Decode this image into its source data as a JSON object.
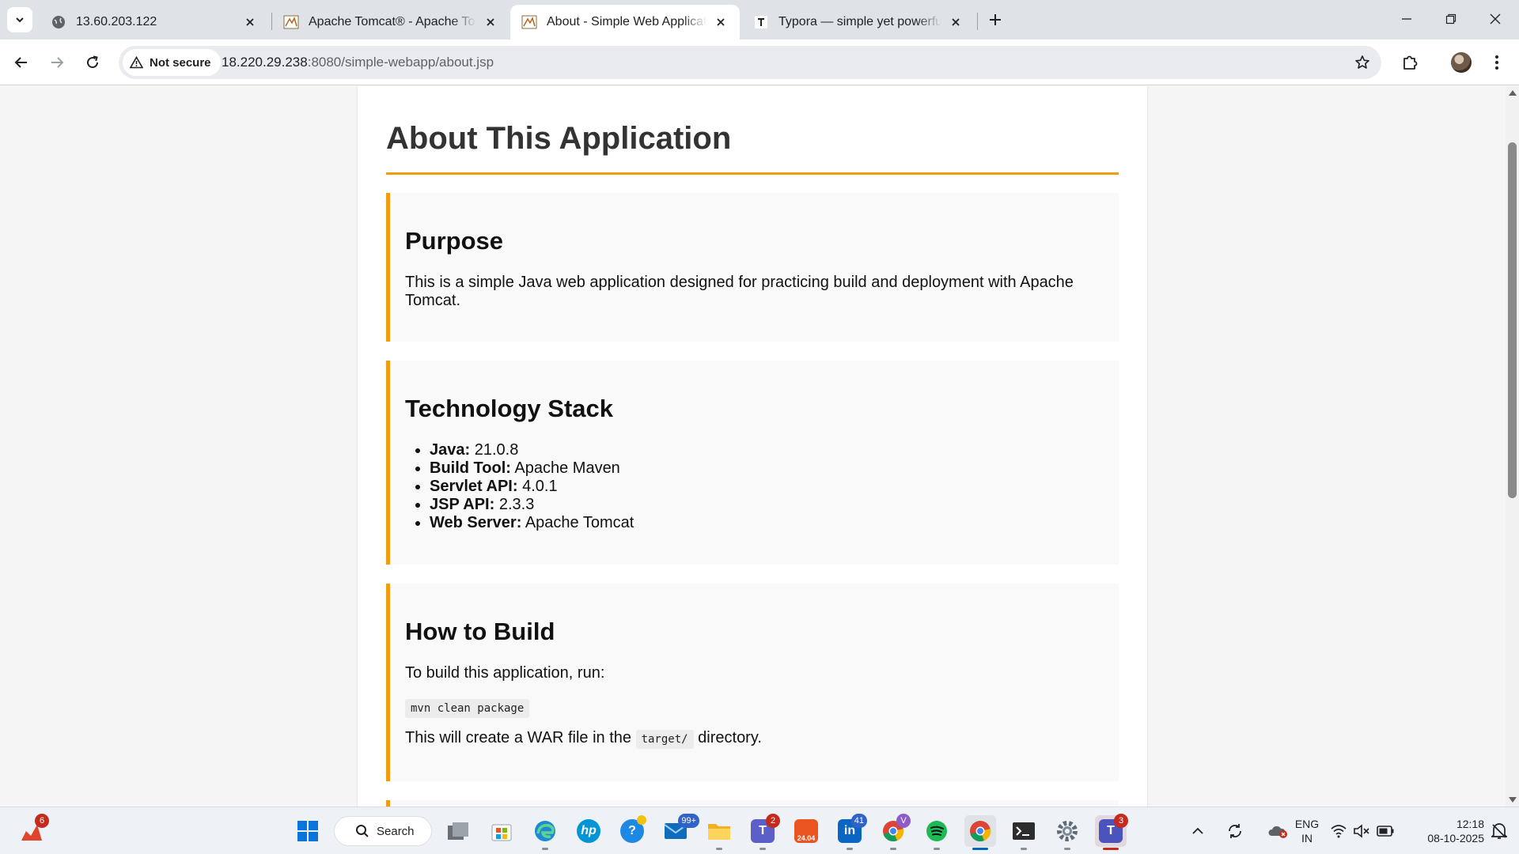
{
  "browser": {
    "tabs": [
      {
        "title": "13.60.203.122",
        "favicon": "globe-icon",
        "active": false
      },
      {
        "title": "Apache Tomcat® - Apache Tomcat",
        "favicon": "tomcat-icon",
        "active": false
      },
      {
        "title": "About - Simple Web Application",
        "favicon": "tomcat-icon",
        "active": true
      },
      {
        "title": "Typora — simple yet powerful Markdown editor",
        "favicon": "typora-icon",
        "active": false
      }
    ],
    "security_label": "Not secure",
    "url_host": "18.220.29.238",
    "url_rest": ":8080/simple-webapp/about.jsp"
  },
  "page": {
    "title": "About This Application",
    "accent_color": "#f39c12",
    "sections": {
      "purpose": {
        "heading": "Purpose",
        "body": "This is a simple Java web application designed for practicing build and deployment with Apache Tomcat."
      },
      "stack": {
        "heading": "Technology Stack",
        "items": [
          {
            "label": "Java:",
            "value": "21.0.8"
          },
          {
            "label": "Build Tool:",
            "value": "Apache Maven"
          },
          {
            "label": "Servlet API:",
            "value": "4.0.1"
          },
          {
            "label": "JSP API:",
            "value": "2.3.3"
          },
          {
            "label": "Web Server:",
            "value": "Apache Tomcat"
          }
        ]
      },
      "build": {
        "heading": "How to Build",
        "intro": "To build this application, run:",
        "command": "mvn clean package",
        "result_before": "This will create a WAR file in the",
        "result_code": "target/",
        "result_after": "directory."
      }
    }
  },
  "taskbar": {
    "search_label": "Search",
    "badges": {
      "widgets": "6",
      "mail": "99+",
      "teams": "2",
      "linkedin": "41",
      "teams_work": "3"
    },
    "ubuntu_label": "24.04",
    "chrome_profile_letter": "V",
    "language_line1": "ENG",
    "language_line2": "IN",
    "time": "12:18",
    "date": "08-10-2025"
  }
}
